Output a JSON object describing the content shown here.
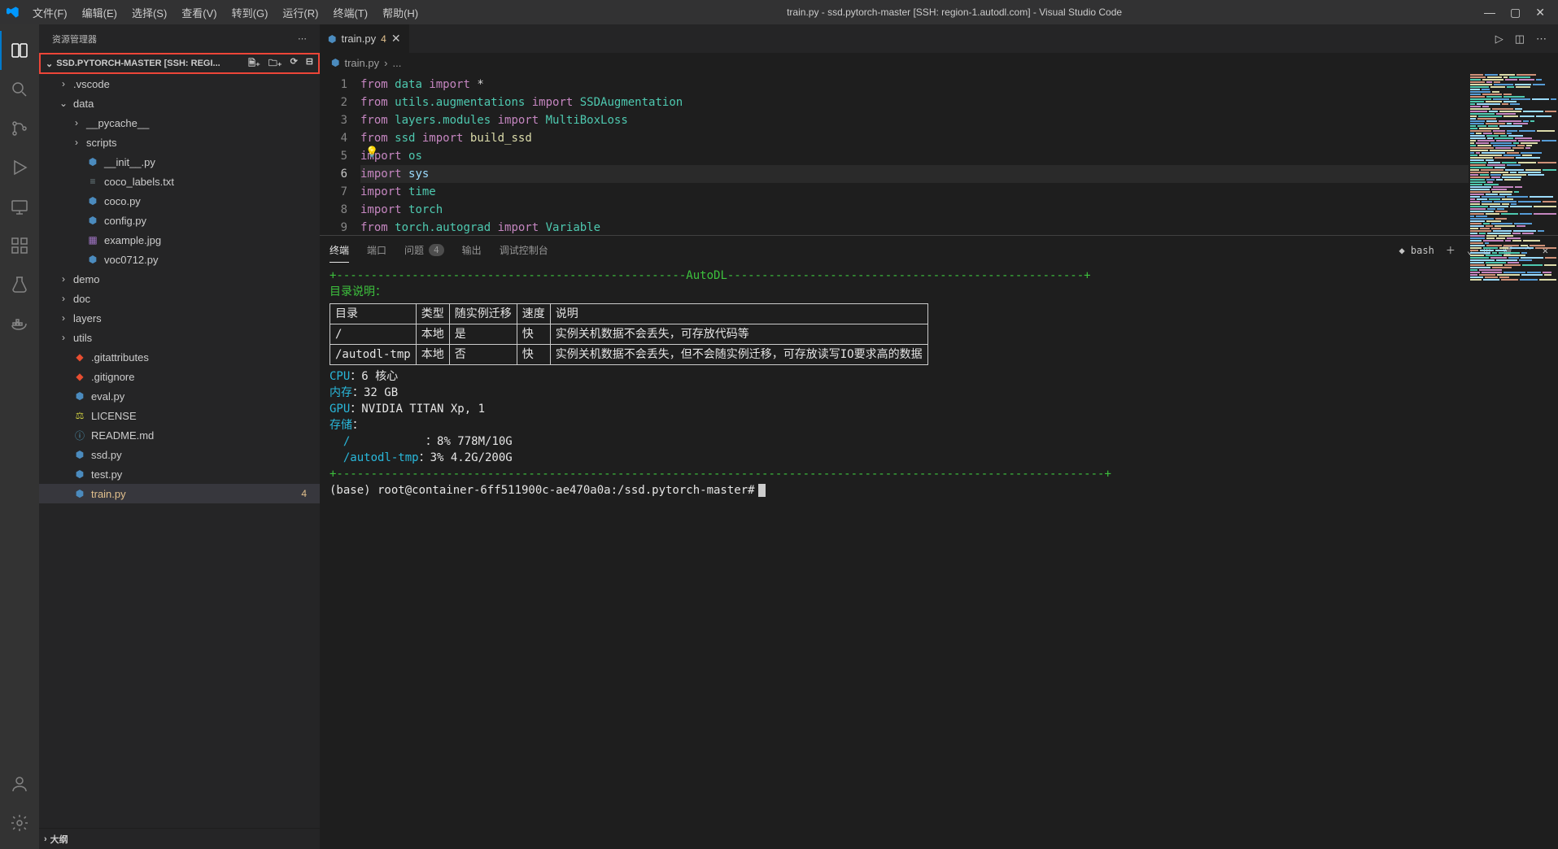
{
  "window": {
    "title": "train.py - ssd.pytorch-master [SSH: region-1.autodl.com] - Visual Studio Code"
  },
  "menu": [
    "文件(F)",
    "编辑(E)",
    "选择(S)",
    "查看(V)",
    "转到(G)",
    "运行(R)",
    "终端(T)",
    "帮助(H)"
  ],
  "sidebar": {
    "title": "资源管理器",
    "root_label": "SSD.PYTORCH-MASTER [SSH: REGI...",
    "outline_label": "大纲",
    "tree": [
      {
        "type": "folder",
        "label": ".vscode",
        "expanded": false,
        "indent": 1
      },
      {
        "type": "folder",
        "label": "data",
        "expanded": true,
        "indent": 1
      },
      {
        "type": "folder",
        "label": "__pycache__",
        "expanded": false,
        "indent": 2
      },
      {
        "type": "folder",
        "label": "scripts",
        "expanded": false,
        "indent": 2
      },
      {
        "type": "file",
        "label": "__init__.py",
        "icon": "py",
        "indent": 2
      },
      {
        "type": "file",
        "label": "coco_labels.txt",
        "icon": "txt",
        "indent": 2
      },
      {
        "type": "file",
        "label": "coco.py",
        "icon": "py",
        "indent": 2
      },
      {
        "type": "file",
        "label": "config.py",
        "icon": "py",
        "indent": 2
      },
      {
        "type": "file",
        "label": "example.jpg",
        "icon": "img",
        "indent": 2
      },
      {
        "type": "file",
        "label": "voc0712.py",
        "icon": "py",
        "indent": 2
      },
      {
        "type": "folder",
        "label": "demo",
        "expanded": false,
        "indent": 1
      },
      {
        "type": "folder",
        "label": "doc",
        "expanded": false,
        "indent": 1
      },
      {
        "type": "folder",
        "label": "layers",
        "expanded": false,
        "indent": 1
      },
      {
        "type": "folder",
        "label": "utils",
        "expanded": false,
        "indent": 1
      },
      {
        "type": "file",
        "label": ".gitattributes",
        "icon": "git",
        "indent": 1
      },
      {
        "type": "file",
        "label": ".gitignore",
        "icon": "git",
        "indent": 1
      },
      {
        "type": "file",
        "label": "eval.py",
        "icon": "py",
        "indent": 1
      },
      {
        "type": "file",
        "label": "LICENSE",
        "icon": "lic",
        "indent": 1
      },
      {
        "type": "file",
        "label": "README.md",
        "icon": "md",
        "indent": 1
      },
      {
        "type": "file",
        "label": "ssd.py",
        "icon": "py",
        "indent": 1
      },
      {
        "type": "file",
        "label": "test.py",
        "icon": "py",
        "indent": 1
      },
      {
        "type": "file",
        "label": "train.py",
        "icon": "py",
        "indent": 1,
        "selected": true,
        "badge": "4"
      }
    ]
  },
  "tabs": {
    "open": {
      "label": "train.py",
      "badge": "4"
    }
  },
  "breadcrumbs": {
    "file": "train.py",
    "sep": "›",
    "more": "..."
  },
  "code": {
    "lines": [
      {
        "n": 1,
        "tokens": [
          {
            "t": "from ",
            "c": "kw"
          },
          {
            "t": "data ",
            "c": "mod"
          },
          {
            "t": "import ",
            "c": "kw"
          },
          {
            "t": "*",
            "c": "op"
          }
        ]
      },
      {
        "n": 2,
        "tokens": [
          {
            "t": "from ",
            "c": "kw"
          },
          {
            "t": "utils.augmentations ",
            "c": "mod"
          },
          {
            "t": "import ",
            "c": "kw"
          },
          {
            "t": "SSDAugmentation",
            "c": "mod"
          }
        ]
      },
      {
        "n": 3,
        "tokens": [
          {
            "t": "from ",
            "c": "kw"
          },
          {
            "t": "layers.modules ",
            "c": "mod"
          },
          {
            "t": "import ",
            "c": "kw"
          },
          {
            "t": "MultiBoxLoss",
            "c": "mod"
          }
        ]
      },
      {
        "n": 4,
        "tokens": [
          {
            "t": "from ",
            "c": "kw"
          },
          {
            "t": "ssd ",
            "c": "mod"
          },
          {
            "t": "import ",
            "c": "kw"
          },
          {
            "t": "build_ssd",
            "c": "fn"
          }
        ]
      },
      {
        "n": 5,
        "tokens": [
          {
            "t": "import ",
            "c": "kw"
          },
          {
            "t": "os",
            "c": "mod"
          }
        ]
      },
      {
        "n": 6,
        "tokens": [
          {
            "t": "import ",
            "c": "kw"
          },
          {
            "t": "sys",
            "c": "mod2"
          }
        ],
        "current": true
      },
      {
        "n": 7,
        "tokens": [
          {
            "t": "import ",
            "c": "kw"
          },
          {
            "t": "time",
            "c": "mod"
          }
        ]
      },
      {
        "n": 8,
        "tokens": [
          {
            "t": "import ",
            "c": "kw"
          },
          {
            "t": "torch",
            "c": "mod"
          }
        ]
      },
      {
        "n": 9,
        "tokens": [
          {
            "t": "from ",
            "c": "kw"
          },
          {
            "t": "torch.autograd ",
            "c": "mod"
          },
          {
            "t": "import ",
            "c": "kw"
          },
          {
            "t": "Variable",
            "c": "mod"
          }
        ]
      }
    ]
  },
  "panel": {
    "tabs": [
      {
        "label": "终端",
        "active": true
      },
      {
        "label": "端口"
      },
      {
        "label": "问题",
        "badge": "4"
      },
      {
        "label": "输出"
      },
      {
        "label": "调试控制台"
      }
    ],
    "shell_label": "bash",
    "terminal": {
      "autodl_banner_label": "AutoDL",
      "dir_desc_label": "目录说明：",
      "headers": [
        "目录",
        "类型",
        "随实例迁移",
        "速度",
        "说明"
      ],
      "rows": [
        [
          "/",
          "本地",
          "是",
          "快",
          "实例关机数据不会丢失，可存放代码等"
        ],
        [
          "/autodl-tmp",
          "本地",
          "否",
          "快",
          "实例关机数据不会丢失，但不会随实例迁移，可存放读写IO要求高的数据"
        ]
      ],
      "cpu_label": "CPU",
      "cpu_val": "：6 核心",
      "mem_label": "内存",
      "mem_val": "：32 GB",
      "gpu_label": "GPU",
      "gpu_val": "：NVIDIA TITAN Xp, 1",
      "storage_label": "存储",
      "storage_colon": "：",
      "storage_line1_path": "/",
      "storage_line1_val": "：8% 778M/10G",
      "storage_line2_path": "/autodl-tmp",
      "storage_line2_val": "：3% 4.2G/200G",
      "prompt": "(base) root@container-6ff511900c-ae470a0a:/ssd.pytorch-master#"
    }
  }
}
